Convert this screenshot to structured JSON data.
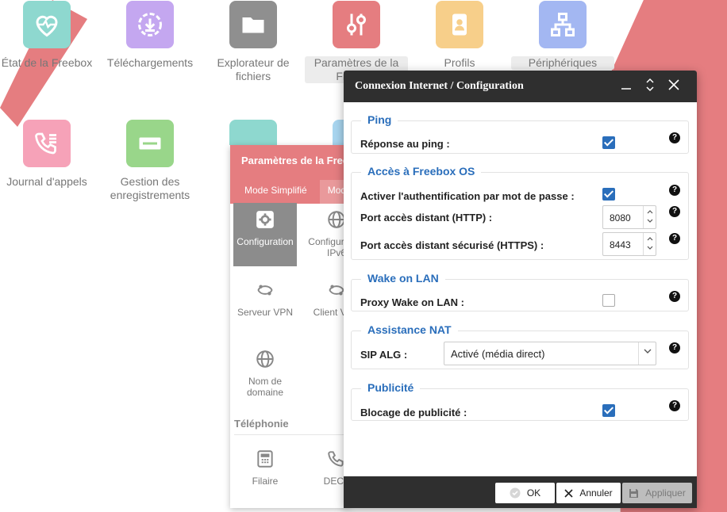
{
  "desktop": {
    "apps": [
      {
        "label": "État de la Freebox",
        "icon": "heart-pulse-icon",
        "color": "#8ed8cf"
      },
      {
        "label": "Téléchargements",
        "icon": "download-icon",
        "color": "#c4a7f0"
      },
      {
        "label": "Explorateur de fichiers",
        "icon": "folder-icon",
        "color": "#8f8f8f"
      },
      {
        "label": "Paramètres de la Freebox",
        "icon": "sliders-icon",
        "color": "#e57d80"
      },
      {
        "label": "Profils",
        "icon": "profile-icon",
        "color": "#f7cf8a"
      },
      {
        "label": "Périphériques",
        "icon": "network-icon",
        "color": "#a3b7f2"
      },
      {
        "label": "Journal d'appels",
        "icon": "phone-list-icon",
        "color": "#f6a2b8"
      },
      {
        "label": "Gestion des enregistrements",
        "icon": "recorder-icon",
        "color": "#99d68a"
      }
    ]
  },
  "settings_window": {
    "title": "Paramètres de la Freebox",
    "tabs": [
      "Mode Simplifié",
      "Mode avancé"
    ],
    "items": [
      "Configuration",
      "Configuration IPv6",
      "Serveur VPN",
      "Client VPN",
      "Nom de domaine",
      "Filaire",
      "DECT"
    ],
    "section_telephony": "Téléphonie"
  },
  "dialog": {
    "title": "Connexion Internet / Configuration",
    "ping": {
      "legend": "Ping",
      "reply_label": "Réponse au ping :",
      "reply_checked": true
    },
    "access": {
      "legend": "Accès à Freebox OS",
      "auth_label": "Activer l'authentification par mot de passe :",
      "auth_checked": true,
      "http_label": "Port accès distant (HTTP) :",
      "http_value": "8080",
      "https_label": "Port accès distant sécurisé (HTTPS) :",
      "https_value": "8443"
    },
    "wol": {
      "legend": "Wake on LAN",
      "proxy_label": "Proxy Wake on LAN :",
      "proxy_checked": false
    },
    "nat": {
      "legend": "Assistance NAT",
      "sip_label": "SIP ALG :",
      "sip_value": "Activé (média direct)"
    },
    "ads": {
      "legend": "Publicité",
      "block_label": "Blocage de publicité :",
      "block_checked": true
    },
    "buttons": {
      "ok": "OK",
      "cancel": "Annuler",
      "apply": "Appliquer"
    },
    "help_glyph": "?",
    "accent_color": "#2a6ebb"
  }
}
